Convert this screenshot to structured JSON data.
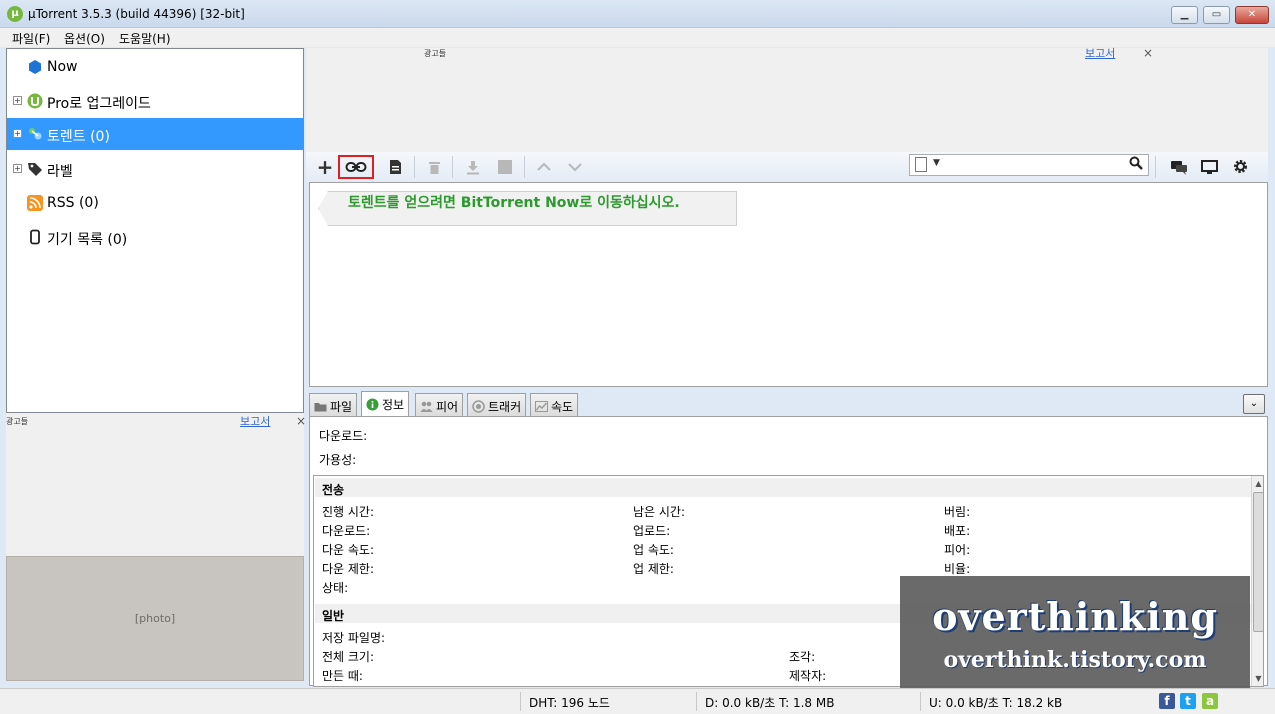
{
  "window": {
    "title": "µTorrent 3.5.3  (build 44396) [32-bit]",
    "min": "▁",
    "max": "▭",
    "close": "✕",
    "app_logo": "µ"
  },
  "menu": [
    "파일(F)",
    "옵션(O)",
    "도움말(H)"
  ],
  "sidebar": {
    "items": [
      {
        "label": "Now",
        "icon": "now-icon",
        "color": "#1e73d6"
      },
      {
        "label": "Pro로 업그레이드",
        "icon": "utorrent-logo-icon",
        "color": "#76b83f"
      },
      {
        "label": "토렌트 (0)",
        "icon": "torrent-icon",
        "selected": true,
        "color": "#3399ff"
      },
      {
        "label": "라벨",
        "icon": "label-tag-icon"
      },
      {
        "label": "RSS (0)",
        "icon": "rss-icon",
        "color": "#f7931e"
      },
      {
        "label": "기기 목록 (0)",
        "icon": "device-icon"
      }
    ]
  },
  "ads": {
    "tag": "광고들",
    "report": "보고서",
    "close": "×"
  },
  "toolbar": {
    "add": "+",
    "add_link": "🔗",
    "create": "▤",
    "delete": "🗑",
    "download": "⤓",
    "stop": "■",
    "up": "⌃",
    "down": "⌄",
    "search_dropdown": "▼",
    "search_glyph": "🔍",
    "chat": "💬",
    "remote": "🖵",
    "settings": "⚙"
  },
  "list": {
    "now_banner": "토렌트를 얻으려면 BitTorrent Now로 이동하십시오."
  },
  "tabs": [
    "파일",
    "정보",
    "피어",
    "트래커",
    "속도"
  ],
  "collapse": "⌄",
  "info": {
    "download": "다운로드:",
    "availability": "가용성:",
    "transfer": {
      "title": "전송",
      "col1": [
        "진행 시간:",
        "다운로드:",
        "다운 속도:",
        "다운 제한:",
        "상태:"
      ],
      "col2": [
        "남은 시간:",
        "업로드:",
        "업 속도:",
        "업 제한:"
      ],
      "col3": [
        "버림:",
        "배포:",
        "피어:",
        "비율:"
      ]
    },
    "general": {
      "title": "일반",
      "col1": [
        "저장 파일명:",
        "전체 크기:",
        "만든 때:"
      ],
      "col2": [
        "조각:",
        "제작자:"
      ]
    },
    "scroll_up": "▲",
    "scroll_down": "▼"
  },
  "watermark": {
    "big": "overthinking",
    "small": "overthink.tistory.com"
  },
  "status": {
    "dht": "DHT: 196 노드",
    "down": "D: 0.0 kB/초 T: 1.8 MB",
    "up": "U: 0.0 kB/초 T: 18.2 kB"
  },
  "social": {
    "facebook": "f",
    "twitter": "t",
    "android": "a"
  }
}
